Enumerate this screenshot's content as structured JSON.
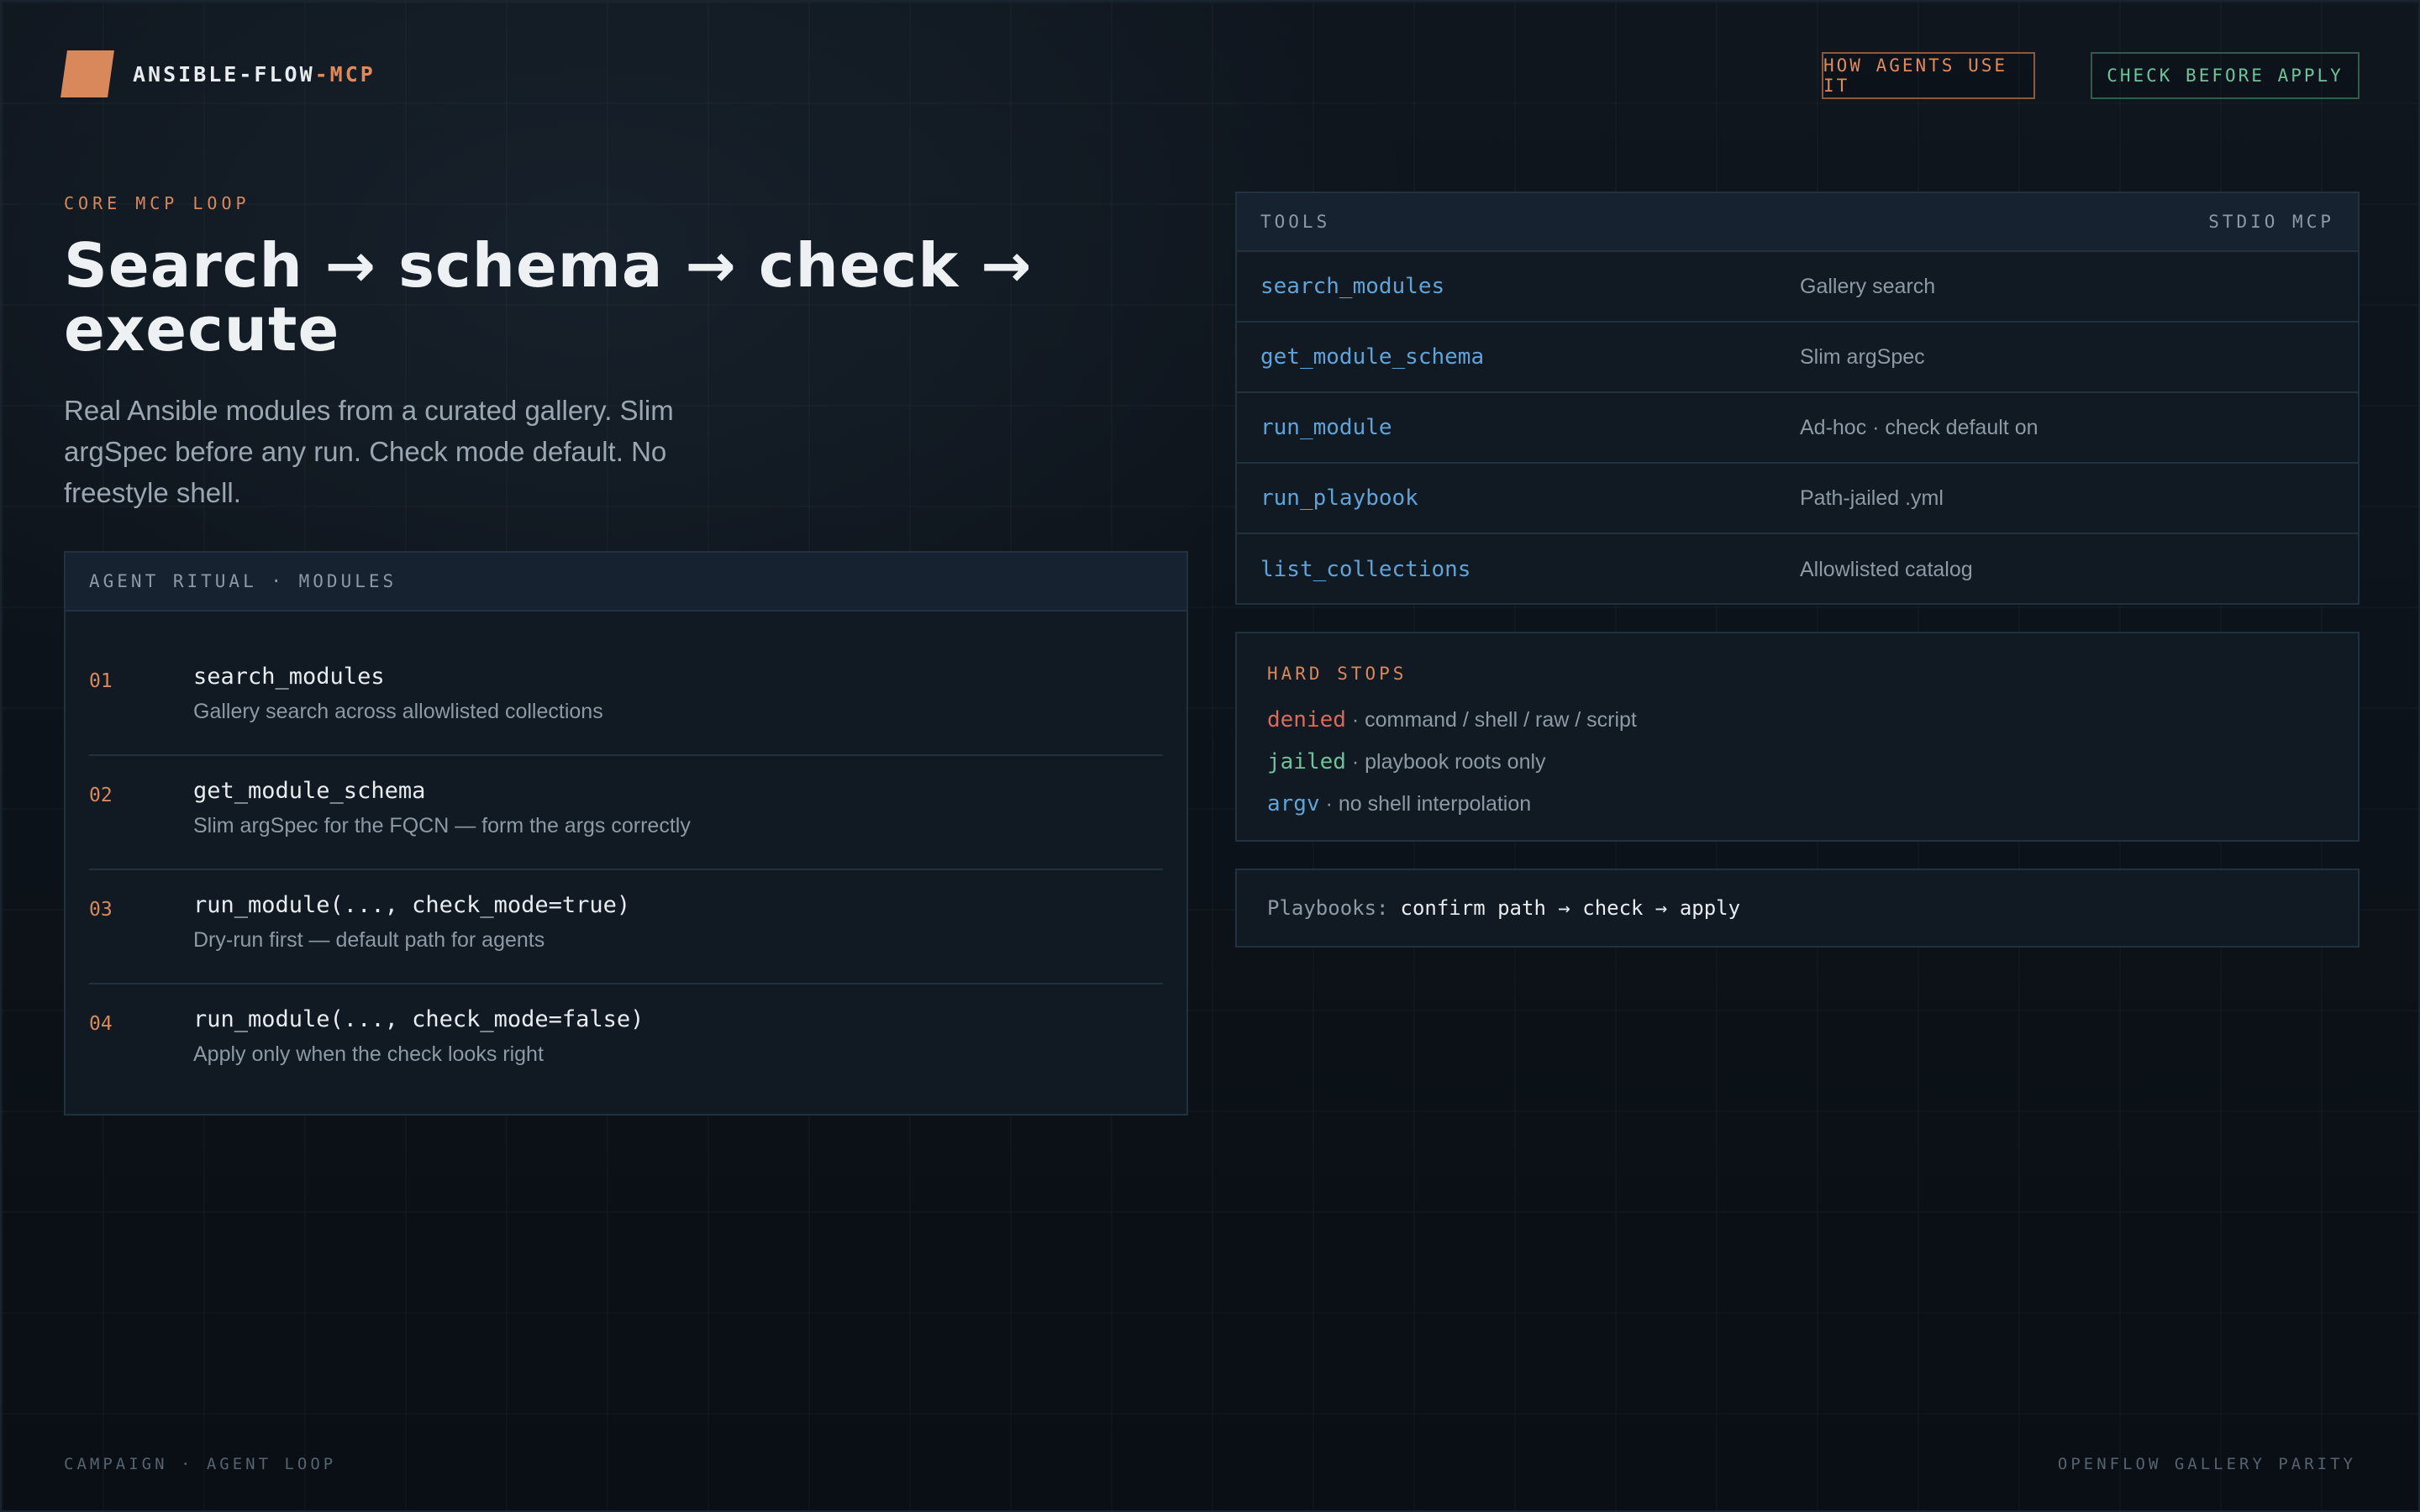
{
  "brand": {
    "name": "ANSIBLE-FLOW",
    "suffix": "-MCP"
  },
  "header": {
    "how_agents_label": "HOW AGENTS USE IT",
    "check_before_label": "CHECK BEFORE APPLY"
  },
  "hero": {
    "eyebrow": "CORE MCP LOOP",
    "title": "Search → schema → check → execute",
    "lede": "Real Ansible modules from a curated gallery. Slim argSpec before any run. Check mode default. No freestyle shell."
  },
  "ritual": {
    "title": "AGENT RITUAL · MODULES",
    "steps": [
      {
        "num": "01",
        "title": "search_modules",
        "desc": "Gallery search across allowlisted collections"
      },
      {
        "num": "02",
        "title": "get_module_schema",
        "desc": "Slim argSpec for the FQCN — form the args correctly"
      },
      {
        "num": "03",
        "title": "run_module(..., check_mode=true)",
        "desc": "Dry-run first — default path for agents"
      },
      {
        "num": "04",
        "title": "run_module(..., check_mode=false)",
        "desc": "Apply only when the check looks right"
      }
    ]
  },
  "tools": {
    "title": "TOOLS",
    "transport": "STDIO MCP",
    "rows": [
      {
        "name": "search_modules",
        "desc": "Gallery search"
      },
      {
        "name": "get_module_schema",
        "desc": "Slim argSpec"
      },
      {
        "name": "run_module",
        "desc": "Ad-hoc · check default on"
      },
      {
        "name": "run_playbook",
        "desc": "Path-jailed .yml"
      },
      {
        "name": "list_collections",
        "desc": "Allowlisted catalog"
      }
    ]
  },
  "hard_stops": {
    "title": "HARD STOPS",
    "items": [
      {
        "key": "denied",
        "text": " · command / shell / raw / script"
      },
      {
        "key": "jailed",
        "text": " · playbook roots only"
      },
      {
        "key": "argv",
        "text": " · no shell interpolation"
      }
    ]
  },
  "playbooks": {
    "label": "Playbooks:",
    "value": "confirm path → check → apply"
  },
  "footer": {
    "left": "CAMPAIGN · AGENT LOOP",
    "right": "OPENFLOW GALLERY PARITY"
  },
  "colors": {
    "accent_orange": "#d9885c",
    "accent_green": "#6ec39a",
    "accent_blue": "#5fa3d8",
    "accent_red": "#d96a5c",
    "background": "#0b1118"
  }
}
